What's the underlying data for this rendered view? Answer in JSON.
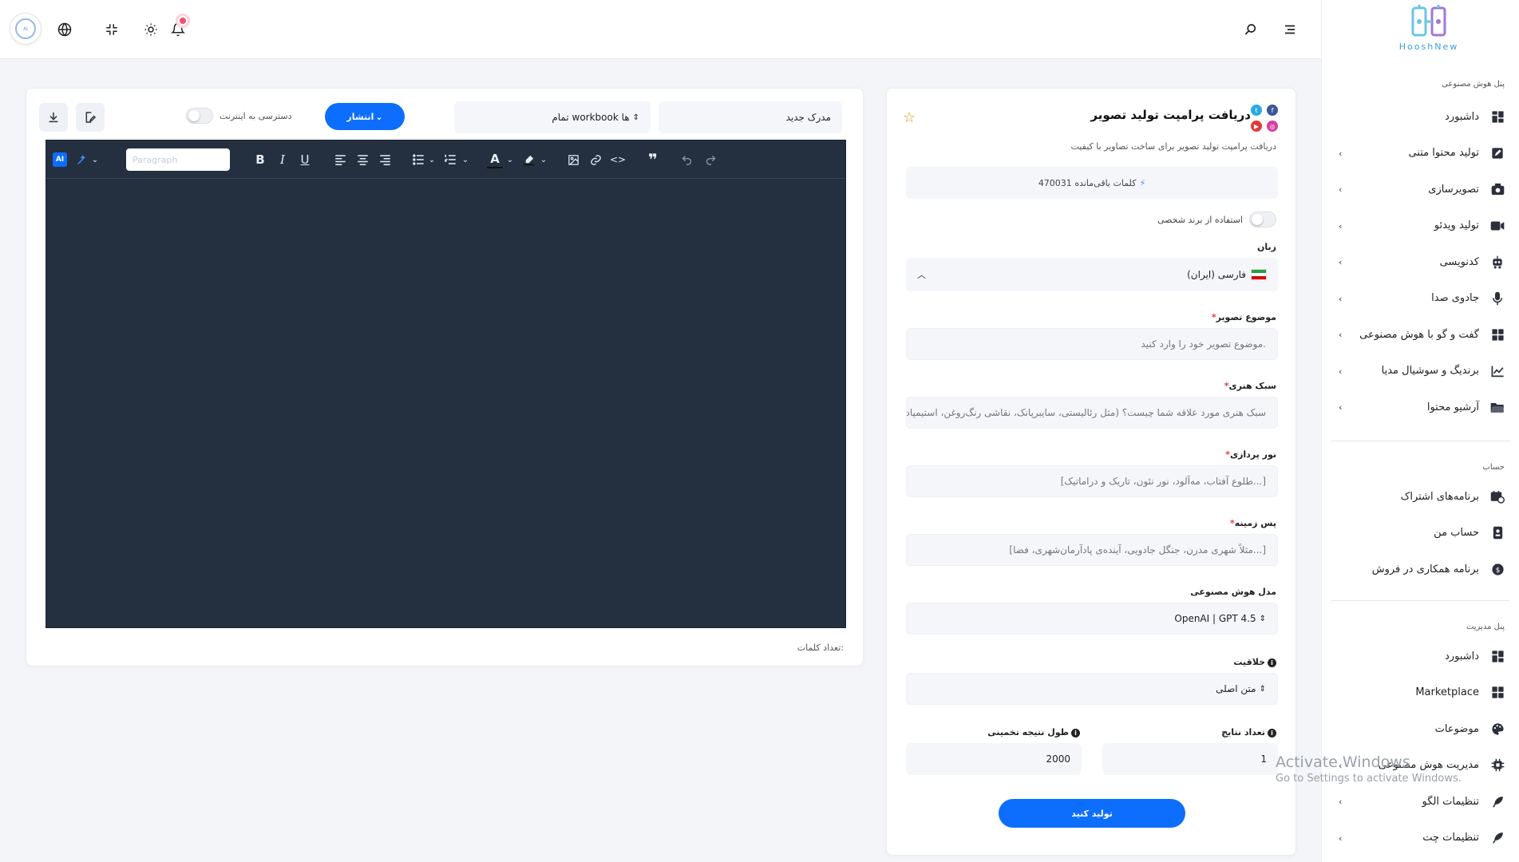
{
  "brand": {
    "name": "HooshNew"
  },
  "topbar": {
    "icons": [
      "avatar",
      "globe-icon",
      "collapse-icon",
      "sun-icon",
      "bell-icon",
      "search-icon",
      "menu-icon"
    ]
  },
  "sidebar": {
    "section_ai": "پنل هوش مصنوعی",
    "ai_items": [
      {
        "label": "داشبورد",
        "icon": "dashboard-icon",
        "chevron": false
      },
      {
        "label": "تولید محتوا متنی",
        "icon": "edit-icon",
        "chevron": true
      },
      {
        "label": "تصویرسازی",
        "icon": "camera-icon",
        "chevron": true
      },
      {
        "label": "تولید ویدئو",
        "icon": "video-icon",
        "chevron": true
      },
      {
        "label": "کدنویسی",
        "icon": "robot-icon",
        "chevron": true
      },
      {
        "label": "جادوی صدا",
        "icon": "mic-icon",
        "chevron": true
      },
      {
        "label": "گفت و گو با هوش مصنوعی",
        "icon": "chat-icon",
        "chevron": true
      },
      {
        "label": "برندیگ و سوشیال مدیا",
        "icon": "chart-icon",
        "chevron": true
      },
      {
        "label": "آرشیو محتوا",
        "icon": "folder-icon",
        "chevron": true
      }
    ],
    "section_account": "حساب",
    "account_items": [
      {
        "label": "برنامه‌های اشتراک",
        "icon": "subscription-icon"
      },
      {
        "label": "حساب من",
        "icon": "user-card-icon"
      },
      {
        "label": "برنامه همکاری در فروش",
        "icon": "dollar-icon"
      }
    ],
    "section_admin": "پنل مدیریت",
    "admin_items": [
      {
        "label": "داشبورد",
        "icon": "dashboard-icon",
        "chevron": false
      },
      {
        "label": "Marketplace",
        "icon": "grid-icon",
        "chevron": false
      },
      {
        "label": "موضوعات",
        "icon": "palette-icon",
        "chevron": false
      },
      {
        "label": "مدیریت هوش مصنوعی",
        "icon": "cpu-icon",
        "chevron": true
      },
      {
        "label": "تنظیمات الگو",
        "icon": "feather-icon",
        "chevron": true
      },
      {
        "label": "تنظیمات چت",
        "icon": "feather-icon",
        "chevron": true
      }
    ]
  },
  "form": {
    "title": "دریافت پرامپت تولید تصویر",
    "subtitle": "دریافت پرامپت تولید تصویر برای ساخت تصاویر با کیفیت",
    "credits_label": "کلمات باقی‌مانده",
    "credits_value": "470031",
    "brand_toggle_label": "استفاده از برند شخصی",
    "language_label": "زبان",
    "language_value": "فارسی (ایران)",
    "topic_label": "موضوع تصویر",
    "topic_placeholder": "موضوع تصویر خود را وارد کنید.",
    "style_label": "سبک هنری",
    "style_placeholder": "سبک هنری مورد علاقه شما چیست؟ (مثل رئالیستی، سایبرپانک، نقاشی رنگ‌روغن، استیمپاد",
    "lighting_label": "نور پردازی",
    "lighting_placeholder": "[طلوع آفتاب، مه‌آلود، نور نئون، تاریک و دراماتیک...]",
    "background_label": "پس زمینه",
    "background_placeholder": "[مثلاً شهری مدرن، جنگل جادویی، آینده‌ی پادآرمان‌شهری، فضا...]",
    "model_label": "مدل هوش مصنوعی",
    "model_value": "OpenAI | GPT 4.5",
    "creativity_label": "خلاقیت",
    "creativity_value": "متن اصلی",
    "results_label": "تعداد نتایج",
    "results_value": "1",
    "length_label": "طول نتیجه تخمینی",
    "length_value": "2000",
    "generate_label": "تولید کنید"
  },
  "editor": {
    "doc_title": "مدرک جدید",
    "workbook_value": "تمام workbook ها",
    "publish_label": "انتشار",
    "web_access_label": "دسترسی به اینترنت",
    "ai_badge": "AI",
    "paragraph_placeholder": "Paragraph",
    "word_count_label": "تعداد کلمات:"
  },
  "watermark": {
    "line1": "Activate Windows",
    "line2": "Go to Settings to activate Windows."
  },
  "colors": {
    "primary": "#0d6efd",
    "editor_bg": "#243040",
    "required": "#e53935"
  }
}
